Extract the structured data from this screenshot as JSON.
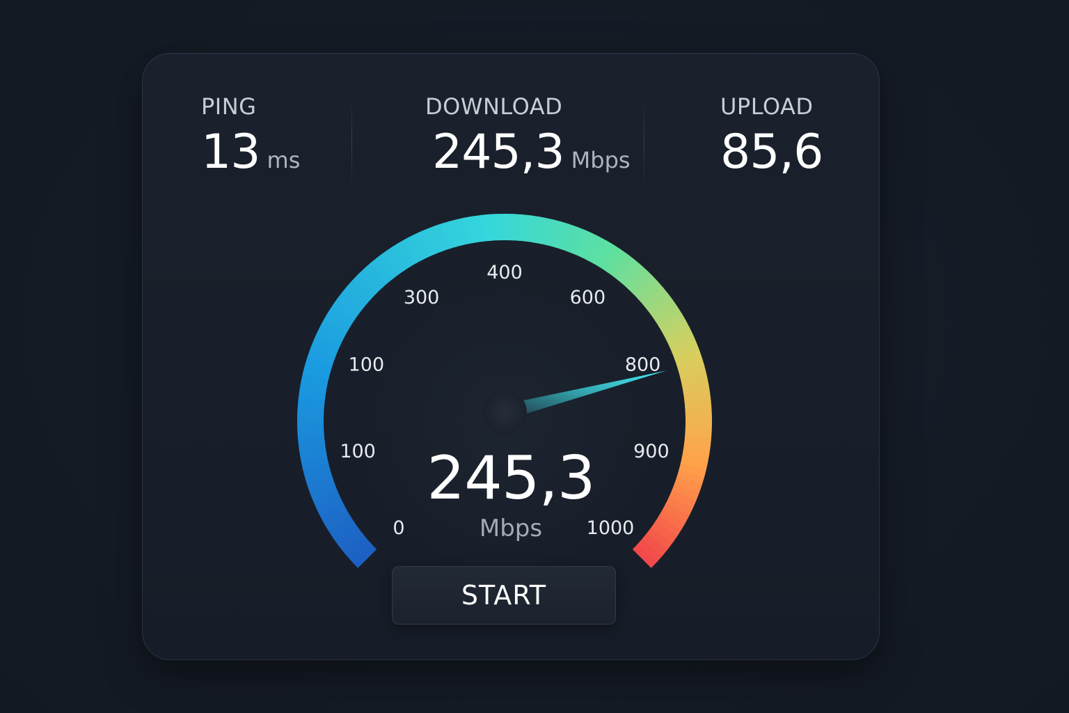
{
  "stats": {
    "ping": {
      "label": "PING",
      "value": "13",
      "unit": "ms"
    },
    "download": {
      "label": "DOWNLOAD",
      "value": "245,3",
      "unit": "Mbps"
    },
    "upload": {
      "label": "UPLOAD",
      "value": "85,6"
    }
  },
  "gauge": {
    "value": "245,3",
    "unit": "Mbps",
    "ticks": [
      "0",
      "100",
      "100",
      "300",
      "400",
      "600",
      "800",
      "900",
      "1000"
    ],
    "needle_fraction": 0.78,
    "colors": {
      "start": "#1d5fc2",
      "mid_blue": "#1a9ae0",
      "cyan": "#35d6dc",
      "green": "#5ee0a0",
      "yellow": "#d7cf5e",
      "orange": "#ffa24a",
      "end": "#f2464a",
      "needle": "#3fe6ef"
    }
  },
  "actions": {
    "start_label": "START"
  }
}
